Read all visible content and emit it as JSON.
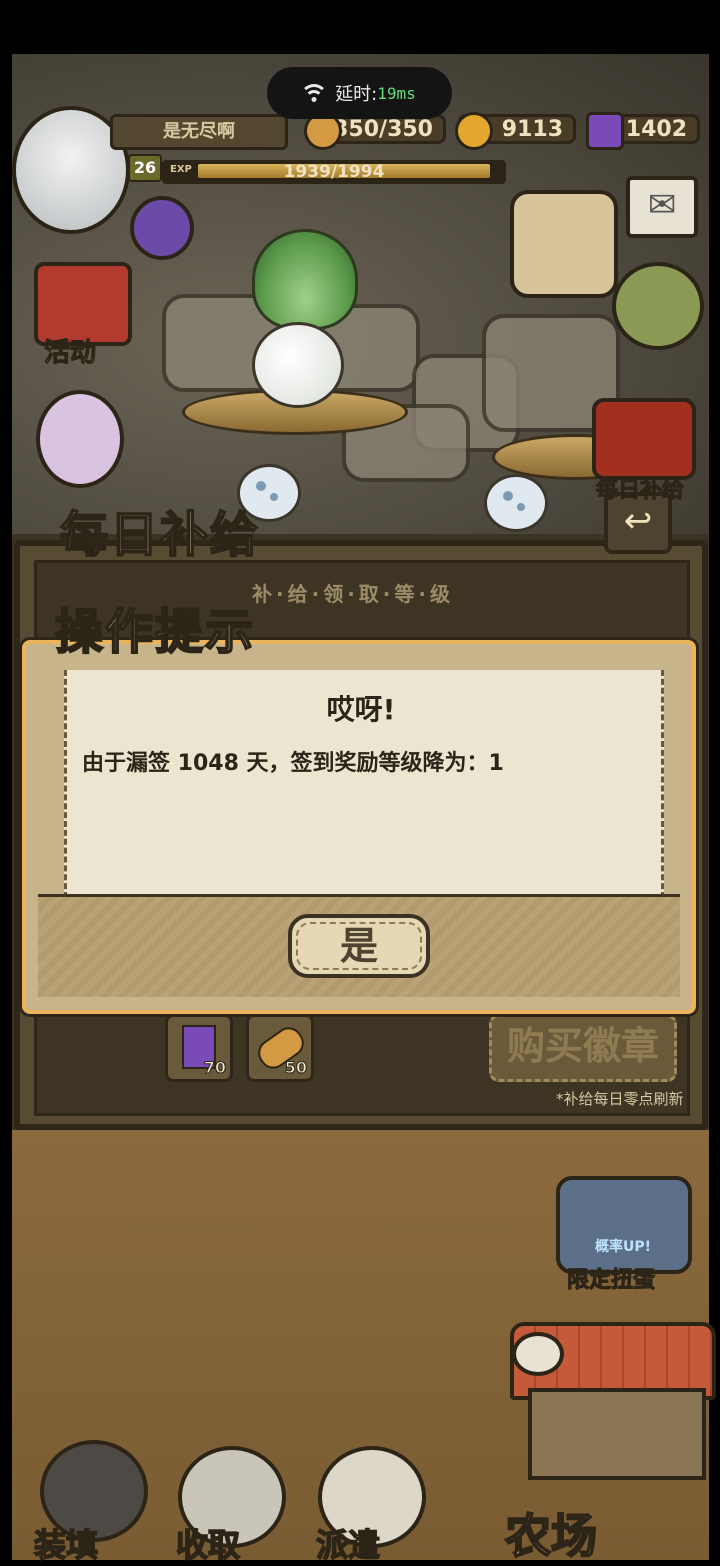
{
  "status_bar": {
    "latency_label": "延时:",
    "latency_value": "19ms"
  },
  "player": {
    "name": "是无尽啊",
    "level": "26",
    "exp_label": "EXP",
    "exp_text": "1939/1994",
    "exp_fraction": 0.972
  },
  "resources": {
    "stamina": "350/350",
    "gold": "9113",
    "gems": "1402"
  },
  "side_menu": {
    "activity_label": "活动",
    "daily_supply_label": "每日补给"
  },
  "daily_panel": {
    "title": "每日补给",
    "subtitle": "补·给·领·取·等·级",
    "items": [
      {
        "icon": "gem-icon",
        "count": "70"
      },
      {
        "icon": "bread-icon",
        "count": "50"
      }
    ],
    "buy_label": "购买徽章",
    "refresh_note": "*补给每日零点刷新"
  },
  "dialog": {
    "title": "操作提示",
    "heading": "哎呀!",
    "message": "由于漏签 1048 天，签到奖励等级降为：1",
    "confirm_label": "是"
  },
  "limited_gacha": {
    "badge": "概率UP!",
    "label": "限定扭蛋"
  },
  "bottom_nav": {
    "equip_label": "装填",
    "collect_label": "收取",
    "dispatch_label": "派遣",
    "farm_label": "农场"
  },
  "colors": {
    "panel_dark": "#2e2719",
    "dialog_border": "#e9b45b",
    "paper": "#ece5d0",
    "latency_green": "#5fe07a"
  }
}
